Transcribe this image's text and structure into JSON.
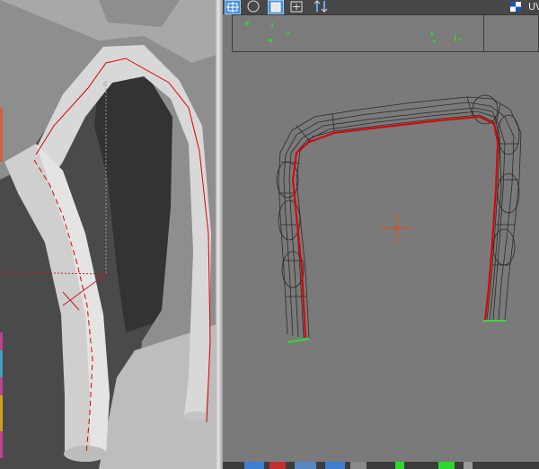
{
  "app": {
    "uv_label": "UV"
  },
  "toolbar": {
    "buttons": [
      {
        "name": "move-tool",
        "icon": "move-icon"
      },
      {
        "name": "rotate-tool",
        "icon": "rotate-icon"
      },
      {
        "name": "scale-tool",
        "icon": "scale-icon"
      },
      {
        "name": "add-tool",
        "icon": "plus-icon"
      },
      {
        "name": "mirror-tool",
        "icon": "mirror-icon"
      },
      {
        "name": "checker-tool",
        "icon": "checker-icon"
      }
    ]
  },
  "colors": {
    "viewport_bg": "#4d4d4d",
    "uv_bg": "#7a7a7a",
    "seam": "#e00000",
    "wire": "#2a2a2a",
    "open_edge": "#33dd33",
    "pivot": "#e05010",
    "active_tool": "#4a8fd8"
  }
}
